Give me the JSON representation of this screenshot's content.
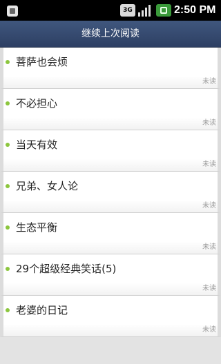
{
  "status_bar": {
    "network": "3G",
    "time": "2:50 PM",
    "icons": [
      "notification-icon",
      "network-3g-icon",
      "signal-icon",
      "battery-icon"
    ]
  },
  "title_bar": {
    "title": "继续上次阅读"
  },
  "list": {
    "items": [
      {
        "title": "菩萨也会烦",
        "status": "未读"
      },
      {
        "title": "不必担心",
        "status": "未读"
      },
      {
        "title": "当天有效",
        "status": "未读"
      },
      {
        "title": "兄弟、女人论",
        "status": "未读"
      },
      {
        "title": "生态平衡",
        "status": "未读"
      },
      {
        "title": "29个超级经典笑话(5)",
        "status": "未读"
      },
      {
        "title": "老婆的日记",
        "status": "未读"
      }
    ]
  },
  "colors": {
    "title_bar": "#2d3f63",
    "bullet": "#8cc63e",
    "status_text": "#9a9a9a"
  }
}
